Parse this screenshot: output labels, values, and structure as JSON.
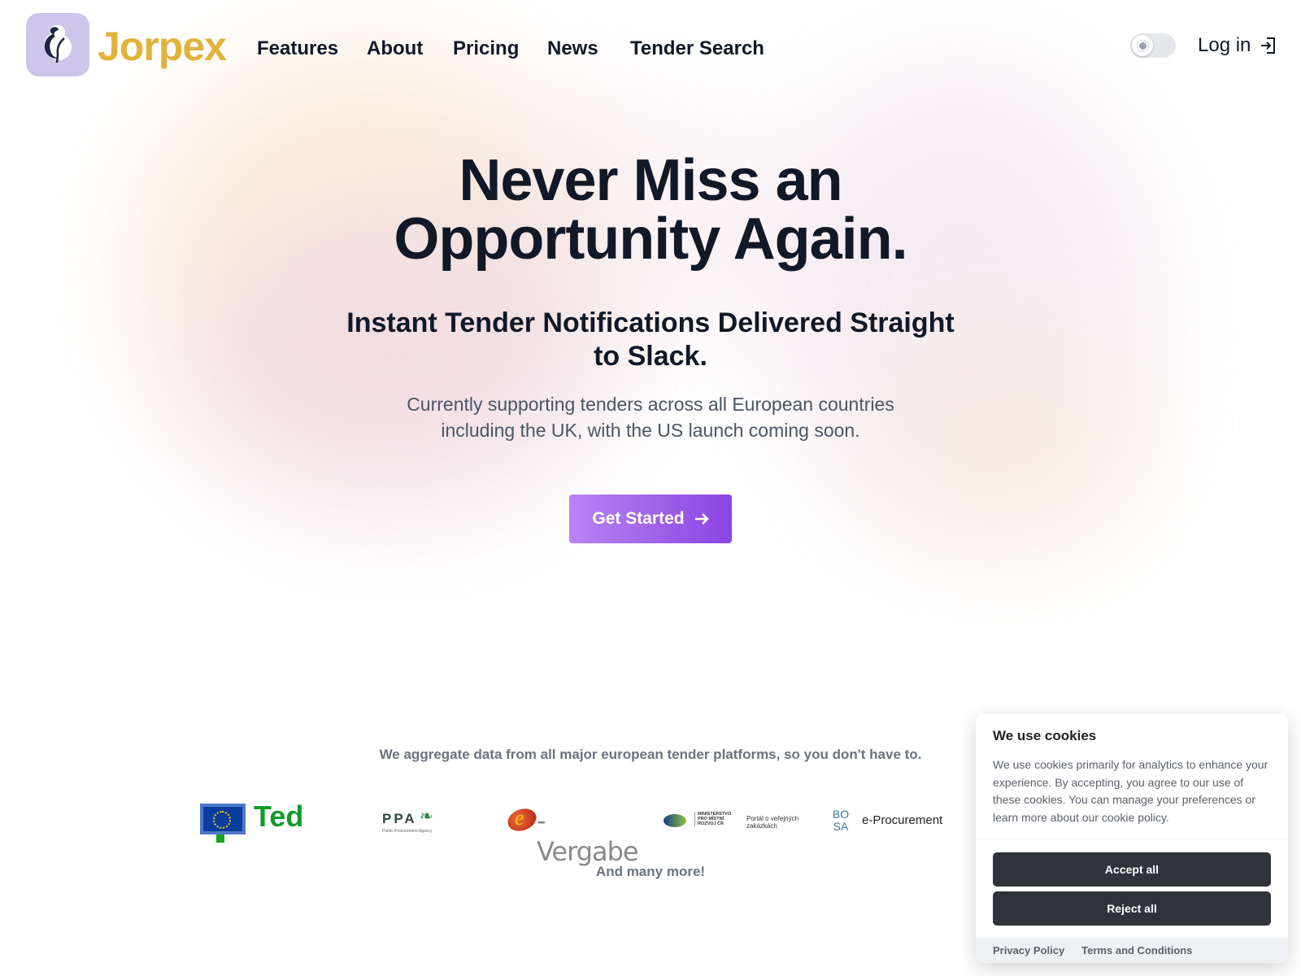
{
  "header": {
    "brand": "Jorpex",
    "nav": [
      "Features",
      "About",
      "Pricing",
      "News",
      "Tender Search"
    ],
    "login": "Log in",
    "theme_toggle": "light"
  },
  "hero": {
    "title_line1": "Never Miss an",
    "title_line2": "Opportunity Again.",
    "subtitle_line1": "Instant Tender Notifications Delivered Straight",
    "subtitle_line2": "to Slack.",
    "lead_line1": "Currently supporting tenders across all European countries",
    "lead_line2": "including the UK, with the US launch coming soon.",
    "cta": "Get Started",
    "cta_color_start": "#b884f2",
    "cta_color_end": "#8a44e2"
  },
  "platforms": {
    "tagline": "We aggregate data from all major european tender platforms, so you don't have to.",
    "logos": {
      "ted": "Ted",
      "ppa": "PPA",
      "ppa_sub": "Public Procurement Agency",
      "evergabe": "-Vergabe",
      "mmr": "MINISTERSTVO PRO MÍSTNÍ ROZVOJ ČR",
      "mmr_portal": "Portál o veřejných zakázkách",
      "bosa": "BO SA",
      "bosa_name": "e-Procurement"
    },
    "more": "And many more!"
  },
  "cookie": {
    "title": "We use cookies",
    "body": "We use cookies primarily for analytics to enhance your experience. By accepting, you agree to our use of these cookies. You can manage your preferences or learn more about our cookie policy.",
    "accept": "Accept all",
    "reject": "Reject all",
    "privacy": "Privacy Policy",
    "terms": "Terms and Conditions"
  },
  "colors": {
    "brand": "#e0b43c",
    "logo_bg": "#cdc5ea",
    "cookie_button": "#30343a"
  }
}
